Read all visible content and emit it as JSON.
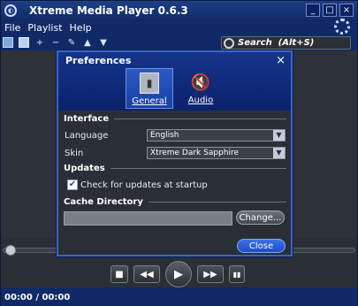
{
  "app": {
    "title": "Xtreme Media Player 0.6.3",
    "window_buttons": [
      "_",
      "□",
      "×"
    ]
  },
  "menu": {
    "items": [
      "File",
      "Playlist",
      "Help"
    ]
  },
  "search": {
    "placeholder": "Search  (Alt+S)"
  },
  "status": {
    "time": "00:00 / 00:00"
  },
  "dialog": {
    "title": "Preferences",
    "close_glyph": "×",
    "tabs": [
      {
        "label": "General",
        "icon": "general-icon",
        "selected": true
      },
      {
        "label": "Audio",
        "icon": "audio-icon",
        "selected": false
      }
    ],
    "sections": {
      "interface": "Interface",
      "updates": "Updates",
      "cache": "Cache Directory"
    },
    "language": {
      "label": "Language",
      "value": "English"
    },
    "skin": {
      "label": "Skin",
      "value": "Xtreme Dark Sapphire"
    },
    "check_updates": {
      "label": "Check for updates at startup",
      "checked": true
    },
    "cache_dir": {
      "value": ""
    },
    "buttons": {
      "change": "Change...",
      "close": "Close"
    }
  },
  "colors": {
    "titlebar": "#1d3f86",
    "dialog_border": "#3b63c8",
    "accent_button": "#3d72ea"
  }
}
